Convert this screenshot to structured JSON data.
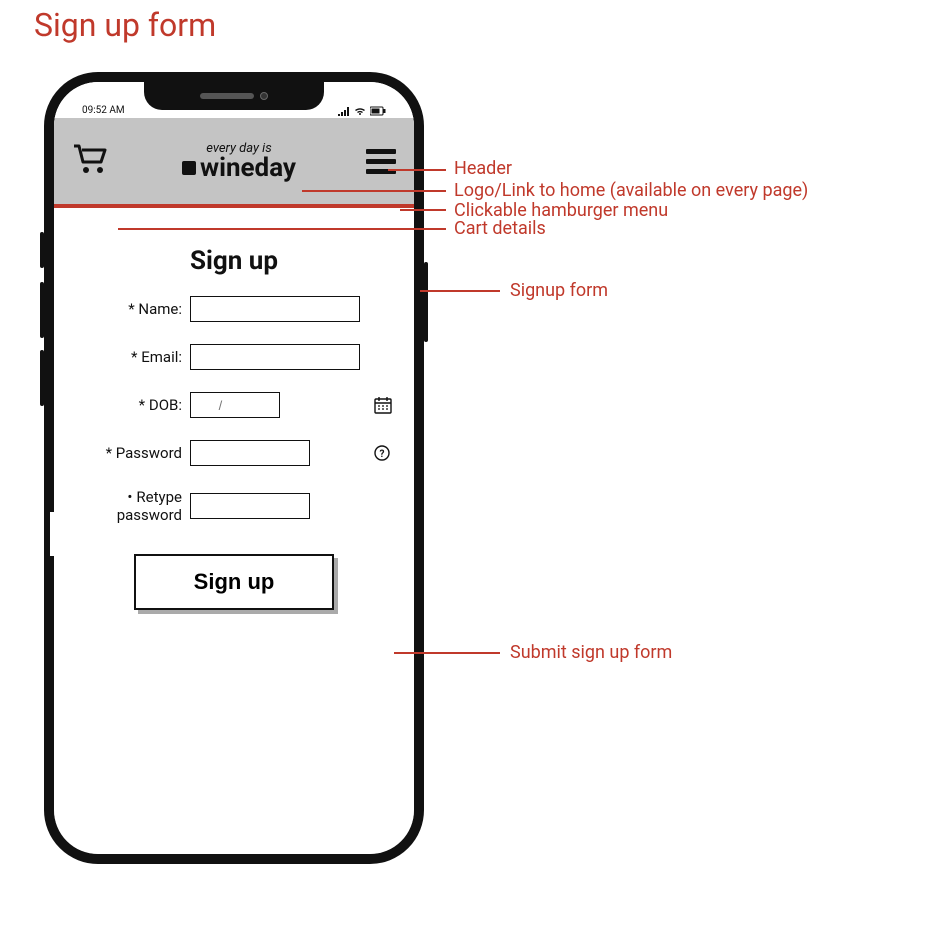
{
  "page_title": "Sign up form",
  "status": {
    "time": "09:52 AM"
  },
  "header": {
    "tagline": "every day is",
    "brand": "wineday"
  },
  "form": {
    "title": "Sign up",
    "name_label": "* Name:",
    "email_label": "* Email:",
    "dob_label": "* DOB:",
    "dob_placeholder": "      /",
    "password_label": "* Password",
    "retype_label": "Retype password",
    "submit_label": "Sign up"
  },
  "annotations": {
    "header": "Header",
    "logo": "Logo/Link to home (available on every page)",
    "hamburger": "Clickable hamburger menu",
    "cart": "Cart details",
    "signup_form": "Signup form",
    "submit": "Submit sign up form"
  }
}
